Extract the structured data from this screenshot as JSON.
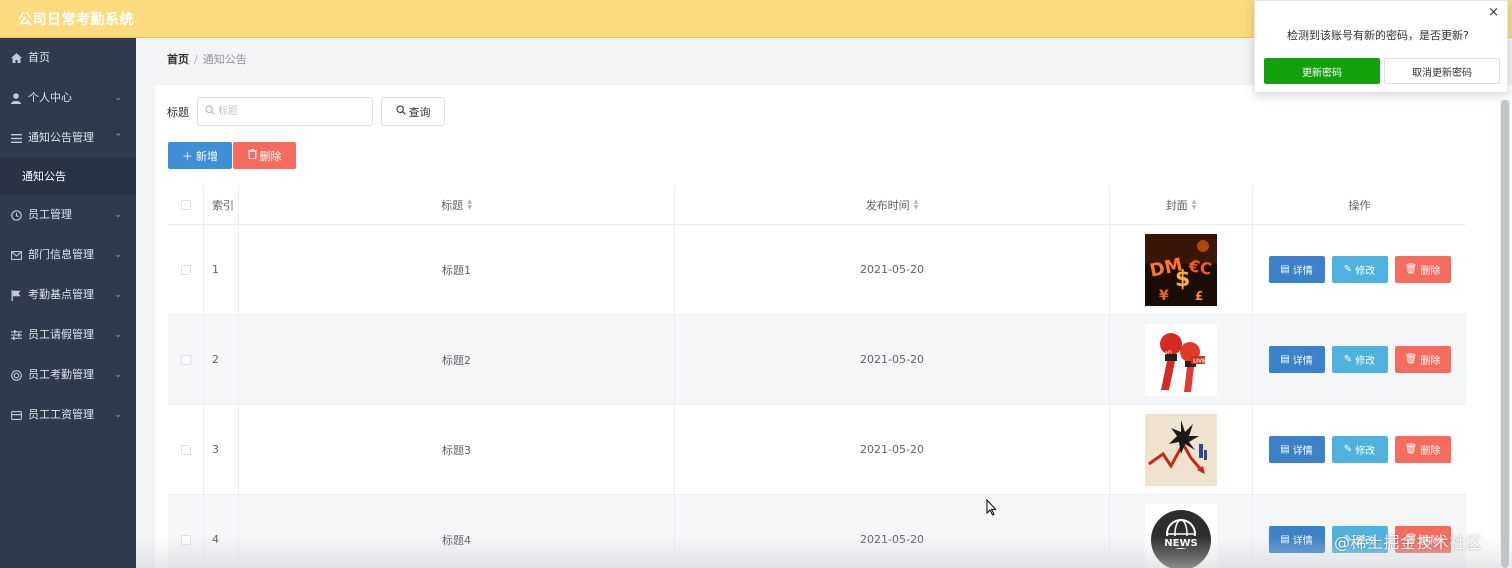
{
  "app": {
    "title": "公司日常考勤系统"
  },
  "sidebar": {
    "items": [
      {
        "label": "首页",
        "icon": "home-icon",
        "has_children": false
      },
      {
        "label": "个人中心",
        "icon": "user-icon",
        "has_children": true,
        "expanded": false
      },
      {
        "label": "通知公告管理",
        "icon": "menu-list-icon",
        "has_children": true,
        "expanded": true
      },
      {
        "label": "通知公告",
        "icon": "",
        "sub": true,
        "active": true
      },
      {
        "label": "员工管理",
        "icon": "clock-icon",
        "has_children": true,
        "expanded": false
      },
      {
        "label": "部门信息管理",
        "icon": "mail-icon",
        "has_children": true,
        "expanded": false
      },
      {
        "label": "考勤基点管理",
        "icon": "flag-icon",
        "has_children": true,
        "expanded": false
      },
      {
        "label": "员工请假管理",
        "icon": "sliders-icon",
        "has_children": true,
        "expanded": false
      },
      {
        "label": "员工考勤管理",
        "icon": "target-icon",
        "has_children": true,
        "expanded": false
      },
      {
        "label": "员工工资管理",
        "icon": "wallet-icon",
        "has_children": true,
        "expanded": false
      }
    ]
  },
  "breadcrumb": {
    "home": "首页",
    "separator": "/",
    "current": "通知公告"
  },
  "search": {
    "label": "标题",
    "placeholder": "标题",
    "value": "",
    "button_label": "查询"
  },
  "actions": {
    "add_label": "新增",
    "delete_label": "删除"
  },
  "table": {
    "columns": {
      "index": "索引",
      "title": "标题",
      "time": "发布时间",
      "cover": "封面",
      "ops": "操作"
    },
    "rows": [
      {
        "index": "1",
        "title": "标题1",
        "time": "2021-05-20",
        "cover": "money-symbols-image"
      },
      {
        "index": "2",
        "title": "标题2",
        "time": "2021-05-20",
        "cover": "live-microphones-image"
      },
      {
        "index": "3",
        "title": "标题3",
        "time": "2021-05-20",
        "cover": "falling-arrow-chart-image"
      },
      {
        "index": "4",
        "title": "标题4",
        "time": "2021-05-20",
        "cover": "news-globe-image"
      }
    ],
    "row_actions": {
      "detail": "详情",
      "edit": "修改",
      "delete": "删除"
    }
  },
  "popup": {
    "message": "检测到该账号有新的密码，是否更新?",
    "confirm_label": "更新密码",
    "cancel_label": "取消更新密码",
    "close_symbol": "×"
  },
  "watermark": "@稀土掘金技术社区",
  "colors": {
    "header_bg": "#fcdb7e",
    "sidebar_bg": "#303a4d",
    "primary": "#3f8fd7",
    "danger": "#f56c5e",
    "info": "#4fb2de",
    "success": "#13a10e"
  }
}
